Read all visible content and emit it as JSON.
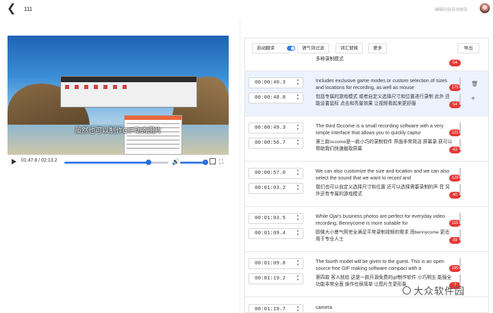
{
  "header": {
    "back_icon": "chevron-left-icon",
    "title": "111",
    "autosave": "编辑内容自动保存"
  },
  "video": {
    "subtitle": "虽然也可以制作GIF动态图片",
    "time_display": "01:47.8 / 02:13.2",
    "progress_fraction": 0.81,
    "volume_fraction": 1.0
  },
  "toolbar": {
    "auto_translate": "自动翻译",
    "auto_translate_on": true,
    "filter_words": "语气词过滤",
    "replace_words": "词汇替换",
    "more": "更多",
    "export": "导出"
  },
  "rows": [
    {
      "start": "",
      "end": "",
      "en": "",
      "zh": "多种录制模式",
      "en_count": "",
      "zh_count": "54",
      "partial": true
    },
    {
      "start": "00:00:40.3",
      "end": "00:00:48.8",
      "en": "Includes exclusive game modes or custom selection of sizes and locations for recording, as well as mouse",
      "zh": "包括专属的游戏模式 或者自定义选择尺寸和位置进行录制 此外 还能设置鼠标 点击和亮量效果 让视频看起来更舒服",
      "en_count": "175",
      "zh_count": "54",
      "active": true
    },
    {
      "start": "00:00:49.3",
      "end": "00:00:56.7",
      "en": "The third Occome is a small recording software with a very simple interface that allows you to quickly captur",
      "zh": "第三款occome是一款小巧的录制软件 界面非常简洁 屏幕录 获可以帮助我们快速截取屏幕",
      "en_count": "121",
      "zh_count": "43"
    },
    {
      "start": "00:00:57.0",
      "end": "00:01:03.2",
      "en": "We can also customize the size and location and we can also select the sound that we want to record and",
      "zh": "我们也可以自定义选择尺寸和位置 还可以选择需要录制的声 音 另外还有专属的游戏模式",
      "en_count": "129",
      "zh_count": "40"
    },
    {
      "start": "00:01:03.5",
      "end": "00:01:09.4",
      "en": "While Ojai's business photos are perfect for everyday video recording, Bennycome is more suitable for",
      "zh": "欧微大小曼气照完全满足平常录制视频的需求 而bennycome 更适用于专业人士",
      "en_count": "115",
      "zh_count": "39"
    },
    {
      "start": "00:01:09.8",
      "end": "00:01:19.2",
      "en": "The fourth model will be given to the guest. This is an open source free GIF making software compact with a",
      "zh": "第四款 客人就给 这是一款开源免费的gif制作软件 小巧明五 能强全 功能非常全面 操作也很简单 让图片生更形象",
      "en_count": "190",
      "zh_count": "?"
    },
    {
      "start": "00:01:19.7",
      "end": "",
      "en": "camera",
      "zh": "",
      "en_count": "",
      "zh_count": "",
      "partial": true
    }
  ],
  "row_icons": {
    "delete": "trash-icon",
    "add": "+"
  },
  "watermark": "大众软件园",
  "colors": {
    "accent": "#2f7be5",
    "badge": "#e53935",
    "active_row": "#ecf3ff"
  }
}
